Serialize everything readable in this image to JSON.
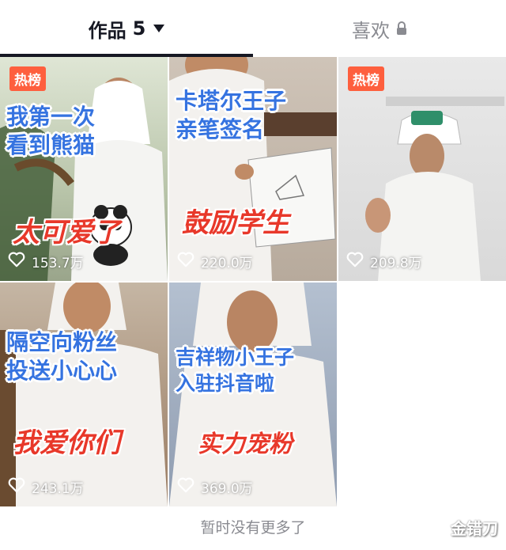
{
  "tabs": {
    "works_label": "作品",
    "works_count": "5",
    "likes_label": "喜欢"
  },
  "videos": [
    {
      "badge": "热榜",
      "caption_lines": [
        "我第一次",
        "看到熊猫"
      ],
      "highlight": "太可爱了",
      "likes": "153.7万"
    },
    {
      "badge": "",
      "caption_lines": [
        "卡塔尔王子",
        "亲笔签名"
      ],
      "highlight": "鼓励学生",
      "likes": "220.0万"
    },
    {
      "badge": "热榜",
      "caption_lines": [],
      "highlight": "",
      "likes": "209.8万"
    },
    {
      "badge": "",
      "caption_lines": [
        "隔空向粉丝",
        "投送小心心"
      ],
      "highlight": "我爱你们",
      "likes": "243.1万"
    },
    {
      "badge": "",
      "caption_lines": [
        "吉祥物小王子",
        "入驻抖音啦"
      ],
      "highlight": "实力宠粉",
      "likes": "369.0万"
    }
  ],
  "footer": "暂时没有更多了",
  "watermark": "金错刀",
  "colors": {
    "active_tab": "#161823",
    "inactive_tab": "#8a8b91",
    "hot_badge": "#fe5f3e",
    "caption_blue": "#3573e0",
    "caption_red": "#e8382a"
  }
}
